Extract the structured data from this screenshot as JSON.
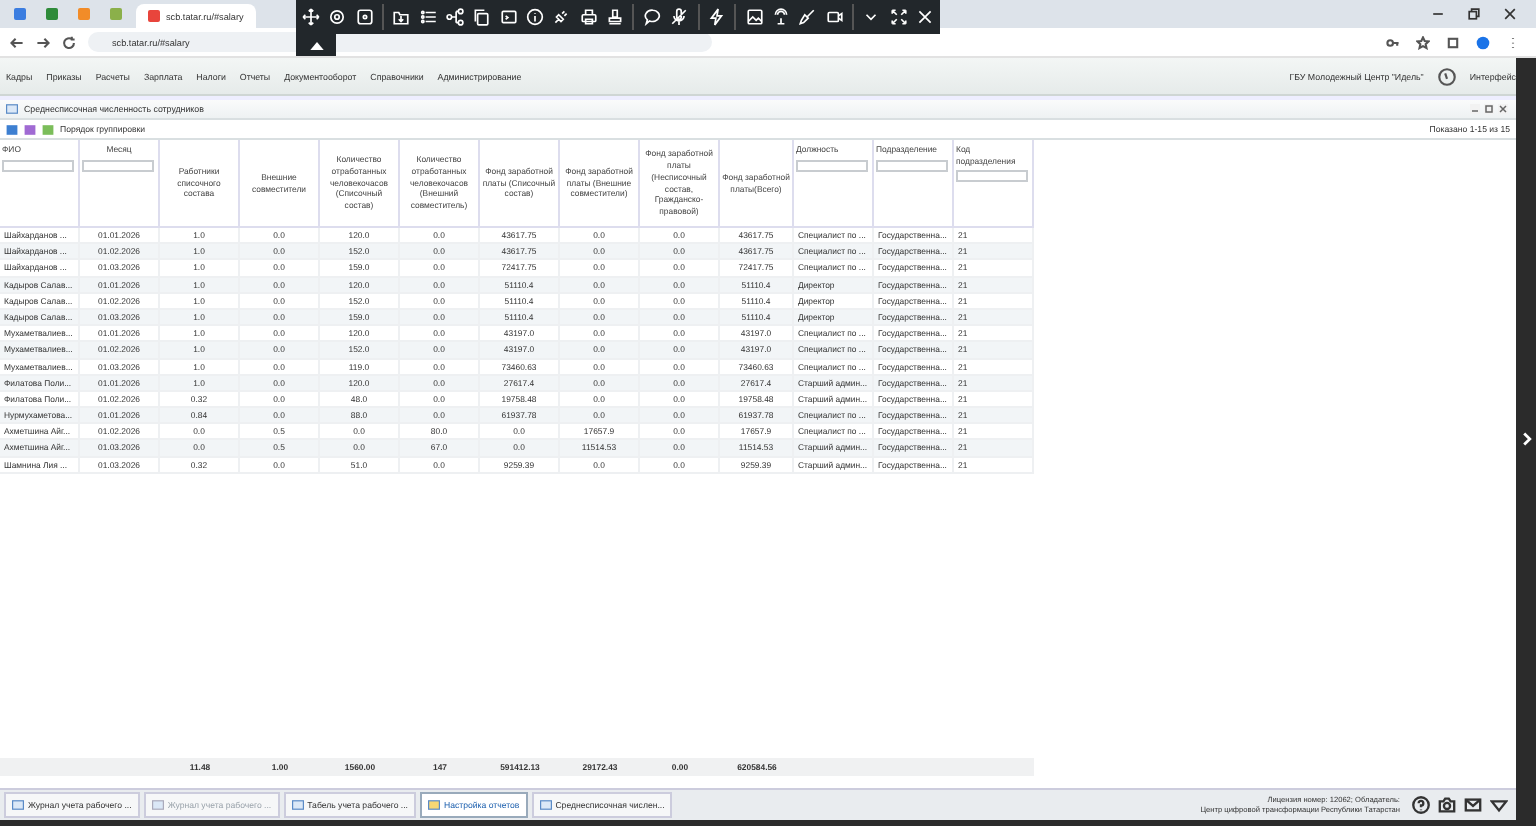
{
  "browser": {
    "tabs": [
      {
        "color": "#3b7de0",
        "selected": false
      },
      {
        "color": "#2e8b3a",
        "selected": false
      },
      {
        "color": "#f28c28",
        "selected": false
      },
      {
        "color": "#8bb04a",
        "selected": false
      },
      {
        "label": "scb.tatar.ru/#salary",
        "color": "#e8453c",
        "selected": true
      }
    ],
    "url": "scb.tatar.ru/#salary"
  },
  "menu": {
    "items": [
      "Кадры",
      "Приказы",
      "Расчеты",
      "Зарплата",
      "Налоги",
      "Отчеты",
      "Документооборот",
      "Справочники",
      "Администрирование"
    ],
    "organization": "ГБУ Молодежный Центр \"Идель\"",
    "user": "Интерфейс"
  },
  "report": {
    "title": "Среднесписочная численность сотрудников",
    "grouping": "Порядок группировки",
    "paging": "Показано 1-15 из 15",
    "columns": [
      {
        "label": "ФИО",
        "kind": "text",
        "filter": true
      },
      {
        "label": "Месяц",
        "kind": "number",
        "filter": true
      },
      {
        "label": "Работники списочного состава",
        "kind": "number",
        "filter": false
      },
      {
        "label": "Внешние совместители",
        "kind": "number",
        "filter": false
      },
      {
        "label": "Количество отработанных человекочасов (Списочный состав)",
        "kind": "number",
        "filter": false
      },
      {
        "label": "Количество отработанных человекочасов (Внешний совместитель)",
        "kind": "number",
        "filter": false
      },
      {
        "label": "Фонд заработной платы (Списочный состав)",
        "kind": "number",
        "filter": false
      },
      {
        "label": "Фонд заработной платы (Внешние совместители)",
        "kind": "number",
        "filter": false
      },
      {
        "label": "Фонд заработной платы (Несписочный состав, Гражданско-правовой)",
        "kind": "number",
        "filter": false
      },
      {
        "label": "Фонд заработной платы(Всего)",
        "kind": "number",
        "filter": false
      },
      {
        "label": "Должность",
        "kind": "text",
        "filter": true
      },
      {
        "label": "Подразделение",
        "kind": "text",
        "filter": true
      },
      {
        "label": "Код подразделения",
        "kind": "text",
        "filter": true
      }
    ],
    "rows": [
      [
        "Шайхарданов ...",
        "01.01.2026",
        "1.0",
        "0.0",
        "120.0",
        "0.0",
        "43617.75",
        "0.0",
        "0.0",
        "43617.75",
        "Специалист по ...",
        "Государственна...",
        "21"
      ],
      [
        "Шайхарданов ...",
        "01.02.2026",
        "1.0",
        "0.0",
        "152.0",
        "0.0",
        "43617.75",
        "0.0",
        "0.0",
        "43617.75",
        "Специалист по ...",
        "Государственна...",
        "21"
      ],
      [
        "Шайхарданов ...",
        "01.03.2026",
        "1.0",
        "0.0",
        "159.0",
        "0.0",
        "72417.75",
        "0.0",
        "0.0",
        "72417.75",
        "Специалист по ...",
        "Государственна...",
        "21"
      ],
      [
        "Кадыров Салав...",
        "01.01.2026",
        "1.0",
        "0.0",
        "120.0",
        "0.0",
        "51110.4",
        "0.0",
        "0.0",
        "51110.4",
        "Директор",
        "Государственна...",
        "21"
      ],
      [
        "Кадыров Салав...",
        "01.02.2026",
        "1.0",
        "0.0",
        "152.0",
        "0.0",
        "51110.4",
        "0.0",
        "0.0",
        "51110.4",
        "Директор",
        "Государственна...",
        "21"
      ],
      [
        "Кадыров Салав...",
        "01.03.2026",
        "1.0",
        "0.0",
        "159.0",
        "0.0",
        "51110.4",
        "0.0",
        "0.0",
        "51110.4",
        "Директор",
        "Государственна...",
        "21"
      ],
      [
        "Мухаметвалиев...",
        "01.01.2026",
        "1.0",
        "0.0",
        "120.0",
        "0.0",
        "43197.0",
        "0.0",
        "0.0",
        "43197.0",
        "Специалист по ...",
        "Государственна...",
        "21"
      ],
      [
        "Мухаметвалиев...",
        "01.02.2026",
        "1.0",
        "0.0",
        "152.0",
        "0.0",
        "43197.0",
        "0.0",
        "0.0",
        "43197.0",
        "Специалист по ...",
        "Государственна...",
        "21"
      ],
      [
        "Мухаметвалиев...",
        "01.03.2026",
        "1.0",
        "0.0",
        "119.0",
        "0.0",
        "73460.63",
        "0.0",
        "0.0",
        "73460.63",
        "Специалист по ...",
        "Государственна...",
        "21"
      ],
      [
        "Филатова Поли...",
        "01.01.2026",
        "1.0",
        "0.0",
        "120.0",
        "0.0",
        "27617.4",
        "0.0",
        "0.0",
        "27617.4",
        "Старший админ...",
        "Государственна...",
        "21"
      ],
      [
        "Филатова Поли...",
        "01.02.2026",
        "0.32",
        "0.0",
        "48.0",
        "0.0",
        "19758.48",
        "0.0",
        "0.0",
        "19758.48",
        "Старший админ...",
        "Государственна...",
        "21"
      ],
      [
        "Нурмухаметова...",
        "01.01.2026",
        "0.84",
        "0.0",
        "88.0",
        "0.0",
        "61937.78",
        "0.0",
        "0.0",
        "61937.78",
        "Специалист по ...",
        "Государственна...",
        "21"
      ],
      [
        "Ахметшина Айг...",
        "01.02.2026",
        "0.0",
        "0.5",
        "0.0",
        "80.0",
        "0.0",
        "17657.9",
        "0.0",
        "17657.9",
        "Специалист по ...",
        "Государственна...",
        "21"
      ],
      [
        "Ахметшина Айг...",
        "01.03.2026",
        "0.0",
        "0.5",
        "0.0",
        "67.0",
        "0.0",
        "11514.53",
        "0.0",
        "11514.53",
        "Старший админ...",
        "Государственна...",
        "21"
      ],
      [
        "Шамнина Лия ...",
        "01.03.2026",
        "0.32",
        "0.0",
        "51.0",
        "0.0",
        "9259.39",
        "0.0",
        "0.0",
        "9259.39",
        "Старший админ...",
        "Государственна...",
        "21"
      ]
    ],
    "totals": [
      "11.48",
      "1.00",
      "1560.00",
      "147",
      "591412.13",
      "29172.43",
      "0.00",
      "620584.56"
    ]
  },
  "taskbar": {
    "tabs": [
      {
        "label": "Журнал учета рабочего ...",
        "selected": false,
        "disabled": false
      },
      {
        "label": "Журнал учета рабочего ...",
        "selected": false,
        "disabled": true
      },
      {
        "label": "Табель учета рабочего ...",
        "selected": false,
        "disabled": false
      },
      {
        "label": "Настройка отчетов",
        "selected": true,
        "disabled": false
      },
      {
        "label": "Среднесписочная числен...",
        "selected": false,
        "disabled": false
      }
    ],
    "license": [
      "Лицензия номер: 12062; Обладатель:",
      "Центр цифровой трансформации Республики Татарстан"
    ]
  }
}
